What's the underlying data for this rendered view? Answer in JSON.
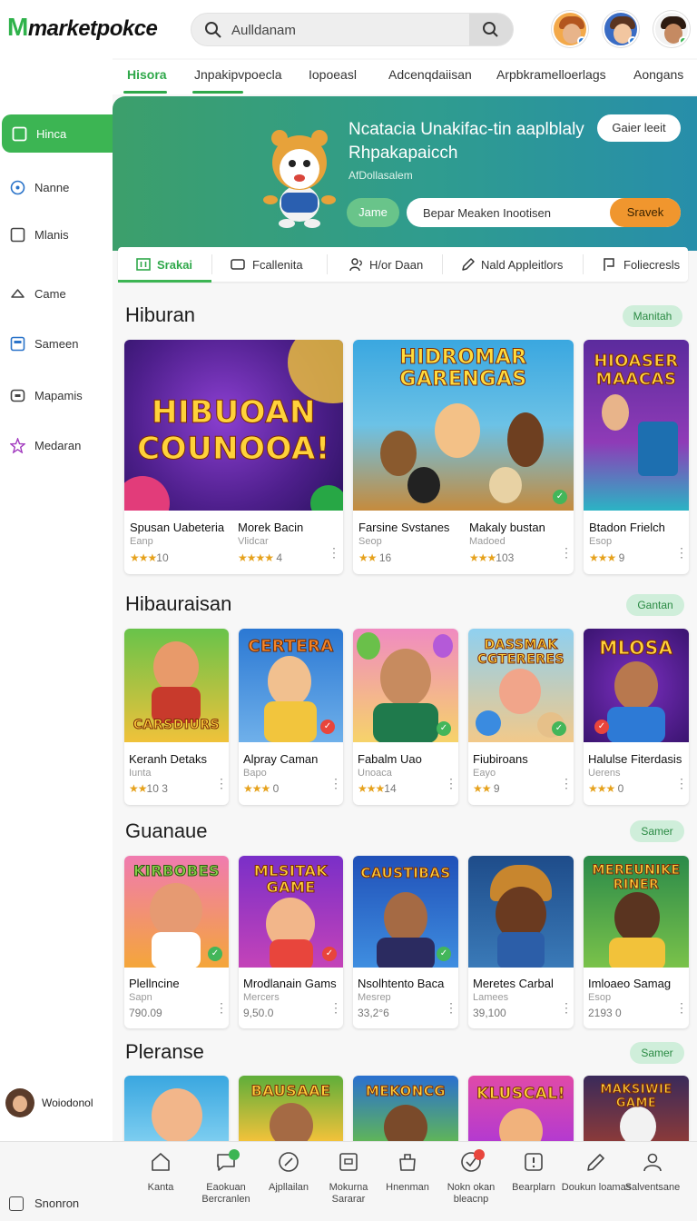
{
  "app": {
    "logo_mark": "M",
    "logo_text": "marketpokce"
  },
  "search": {
    "value": "Aulldanam"
  },
  "header_avatars": [
    {
      "name": "avatar-1"
    },
    {
      "name": "avatar-2"
    },
    {
      "name": "avatar-3"
    }
  ],
  "topnav": [
    "Hisora",
    "Jnpakipvpoecla",
    "Iopoeasl",
    "Adcenqdaiisan",
    "Arpbkramelloerlags",
    "Aongans"
  ],
  "sidebar": {
    "items": [
      {
        "label": "Hinca",
        "icon": "square-icon",
        "active": true
      },
      {
        "label": "Nanne",
        "icon": "target-icon"
      },
      {
        "label": "Mlanis",
        "icon": "square-icon"
      },
      {
        "label": "Came",
        "icon": "cloud-icon"
      },
      {
        "label": "Sameen",
        "icon": "screen-icon"
      },
      {
        "label": "Mapamis",
        "icon": "box-icon"
      },
      {
        "label": "Medaran",
        "icon": "star-icon"
      }
    ],
    "user": "Woiodonol"
  },
  "hero": {
    "title": "Ncatacia Unakifac-tin aaplblaly Rhpakapaicch",
    "subtitle": "AfDollasalem",
    "pill_button": "Gaier leeit",
    "chip": "Jame",
    "input_value": "Bepar Meaken Inootisen",
    "action": "Sravek"
  },
  "filters": [
    {
      "label": "Srakai",
      "icon": "grid-icon"
    },
    {
      "label": "Fcallenita",
      "icon": "screen-icon"
    },
    {
      "label": "H/or Daan",
      "icon": "people-icon"
    },
    {
      "label": "Nald Appleitlors",
      "icon": "pencil-icon"
    },
    {
      "label": "Foliecresls",
      "icon": "flag-icon"
    }
  ],
  "sections": [
    {
      "title": "Hiburan",
      "button": "Manitah",
      "cards": [
        {
          "name": "Spusan Uabeteria",
          "sub": "Eanp",
          "rating": "★★★",
          "rating_text": "10",
          "art_text": "HIBUOAN COUNOOA!"
        },
        {
          "name": "Morek Bacin",
          "sub": "Vlidcar",
          "rating": "★★★★",
          "rating_text": "4",
          "art_text": ""
        },
        {
          "name": "Farsine Svstanes",
          "sub": "Seop",
          "rating": "★★",
          "rating_text": "16",
          "art_text": "HIDROMAR GARENGAS"
        },
        {
          "name": "Makaly bustan",
          "sub": "Madoed",
          "rating": "★★★",
          "rating_text": "103",
          "art_text": ""
        },
        {
          "name": "Btadon Frielch",
          "sub": "Esop",
          "rating": "★★★",
          "rating_text": "9",
          "art_text": "HIOASER MAACAS"
        }
      ]
    },
    {
      "title": "Hibauraisan",
      "button": "Gantan",
      "cards": [
        {
          "name": "Keranh Detaks",
          "sub": "Iunta",
          "rating": "★★",
          "rating_text": "10 3",
          "art_text": "CARSDIURS"
        },
        {
          "name": "Alpray Caman",
          "sub": "Bapo",
          "rating": "★★★",
          "rating_text": "0",
          "art_text": "CERTERA"
        },
        {
          "name": "Fabalm Uao",
          "sub": "Unoaca",
          "rating": "★★★",
          "rating_text": "14",
          "art_text": ""
        },
        {
          "name": "Fiubiroans",
          "sub": "Eayo",
          "rating": "★★",
          "rating_text": "9",
          "art_text": "DASSMAK CGTERERES"
        },
        {
          "name": "Halulse Fiterdasis",
          "sub": "Uerens",
          "rating": "★★★",
          "rating_text": "0",
          "art_text": "MLOSA"
        }
      ]
    },
    {
      "title": "Guanaue",
      "button": "Samer",
      "cards": [
        {
          "name": "Plellncine",
          "sub": "Sapn",
          "rating": "",
          "rating_text": "790.09",
          "art_text": "KIRBOBES"
        },
        {
          "name": "Mrodlanain Gams",
          "sub": "Mercers",
          "rating": "",
          "rating_text": "9,50.0",
          "art_text": "MLSITAK GAME"
        },
        {
          "name": "Nsolhtento Baca",
          "sub": "Mesrep",
          "rating": "",
          "rating_text": "33,2°6",
          "art_text": "CAUSTIBAS"
        },
        {
          "name": "Meretes Carbal",
          "sub": "Lamees",
          "rating": "",
          "rating_text": "39,100",
          "art_text": ""
        },
        {
          "name": "Imloaeo Samag",
          "sub": "Esop",
          "rating": "",
          "rating_text": "2193 0",
          "art_text": "MEREUNIKE RINER"
        }
      ]
    },
    {
      "title": "Pleranse",
      "button": "Samer",
      "cards": [
        {
          "art_text": ""
        },
        {
          "art_text": "BAUSAAE"
        },
        {
          "art_text": "MEKONCG"
        },
        {
          "art_text": "KLUSCAL!"
        },
        {
          "art_text": "MAKSIWIE GAME"
        }
      ]
    }
  ],
  "bottombar": {
    "side_label": "Snonron",
    "items": [
      {
        "label": "Kanta",
        "icon": "house-icon"
      },
      {
        "label": "Eaokuan Bercranlen",
        "icon": "chat-icon"
      },
      {
        "label": "Ajpllailan",
        "icon": "compass-icon"
      },
      {
        "label": "Mokurna Sararar",
        "icon": "doc-icon"
      },
      {
        "label": "Hnenman",
        "icon": "bag-icon"
      },
      {
        "label": "Nokn okan bleacnp",
        "icon": "check-circle-icon"
      },
      {
        "label": "Bearplarn",
        "icon": "info-icon"
      },
      {
        "label": "Doukun loamas",
        "icon": "pen-icon"
      },
      {
        "label": "Salventsane",
        "icon": "person-icon"
      }
    ]
  },
  "colors": {
    "accent": "#3cb553",
    "hero_from": "#3c9f6b",
    "hero_to": "#278eaa",
    "action": "#f0962e"
  }
}
